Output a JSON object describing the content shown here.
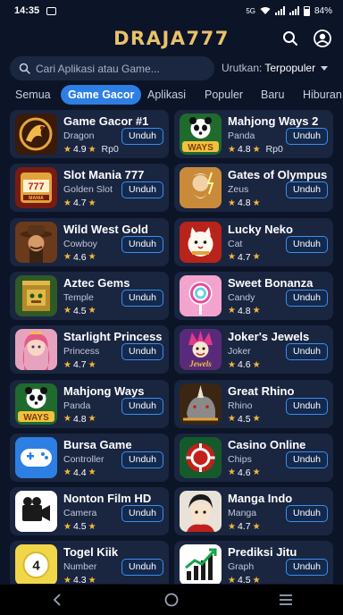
{
  "status": {
    "time": "14:35",
    "battery": "84%",
    "network": "5G"
  },
  "header": {
    "brand": "DRAJA777"
  },
  "search": {
    "placeholder": "Cari Aplikasi atau Game..."
  },
  "sort": {
    "label": "Urutkan:",
    "value": "Terpopuler"
  },
  "tabs": [
    "Semua",
    "Game Gacor",
    "Aplikasi",
    "Populer",
    "Baru",
    "Hiburan"
  ],
  "active_tab": "Game Gacor",
  "apps": [
    {
      "title": "Game Gacor #1",
      "category": "Dragon",
      "rating": "4.9",
      "price": "Rp0",
      "button": "Unduh",
      "icon": "dragon-icon",
      "bg": "#3a1a08"
    },
    {
      "title": "Mahjong Ways 2",
      "category": "Panda",
      "rating": "4.8",
      "price": "Rp0",
      "button": "Unduh",
      "icon": "panda-ways-icon",
      "bg": "#1f6b2e"
    },
    {
      "title": "Slot Mania 777",
      "category": "Golden Slot",
      "rating": "4.7",
      "price": "",
      "button": "Unduh",
      "icon": "slot-machine-icon",
      "bg": "#7a1b12"
    },
    {
      "title": "Gates of Olympus",
      "category": "Zeus",
      "rating": "4.8",
      "price": "",
      "button": "Unduh",
      "icon": "zeus-icon",
      "bg": "#c98b3a"
    },
    {
      "title": "Wild West Gold",
      "category": "Cowboy",
      "rating": "4.6",
      "price": "",
      "button": "Unduh",
      "icon": "cowboy-icon",
      "bg": "#6b3a1c"
    },
    {
      "title": "Lucky Neko",
      "category": "Cat",
      "rating": "4.7",
      "price": "",
      "button": "Unduh",
      "icon": "lucky-cat-icon",
      "bg": "#b8241c"
    },
    {
      "title": "Aztec Gems",
      "category": "Temple",
      "rating": "4.5",
      "price": "",
      "button": "Unduh",
      "icon": "aztec-temple-icon",
      "bg": "#2f5a26"
    },
    {
      "title": "Sweet Bonanza",
      "category": "Candy",
      "rating": "4.8",
      "price": "",
      "button": "Unduh",
      "icon": "candy-icon",
      "bg": "#f2a4cf"
    },
    {
      "title": "Starlight Princess",
      "category": "Princess",
      "rating": "4.7",
      "price": "",
      "button": "Unduh",
      "icon": "princess-icon",
      "bg": "#e7a3bd"
    },
    {
      "title": "Joker's Jewels",
      "category": "Joker",
      "rating": "4.6",
      "price": "",
      "button": "Unduh",
      "icon": "joker-icon",
      "bg": "#5a2a7a"
    },
    {
      "title": "Mahjong Ways",
      "category": "Panda",
      "rating": "4.8",
      "price": "",
      "button": "Unduh",
      "icon": "panda-ways-icon",
      "bg": "#1f6b2e"
    },
    {
      "title": "Great Rhino",
      "category": "Rhino",
      "rating": "4.5",
      "price": "",
      "button": "Unduh",
      "icon": "rhino-icon",
      "bg": "#3a2612"
    },
    {
      "title": "Bursa Game",
      "category": "Controller",
      "rating": "4.4",
      "price": "",
      "button": "Unduh",
      "icon": "gamepad-icon",
      "bg": "#2d7fe3"
    },
    {
      "title": "Casino Online",
      "category": "Chips",
      "rating": "4.6",
      "price": "",
      "button": "Unduh",
      "icon": "casino-chip-icon",
      "bg": "#155a2a"
    },
    {
      "title": "Nonton Film HD",
      "category": "Camera",
      "rating": "4.5",
      "price": "",
      "button": "Unduh",
      "icon": "video-camera-icon",
      "bg": "#ffffff"
    },
    {
      "title": "Manga Indo",
      "category": "Manga",
      "rating": "4.7",
      "price": "",
      "button": "Unduh",
      "icon": "manga-icon",
      "bg": "#e8e2d8"
    },
    {
      "title": "Togel Kiik",
      "category": "Number",
      "rating": "4.3",
      "price": "",
      "button": "Unduh",
      "icon": "lottery-ball-icon",
      "bg": "#f2d64a"
    },
    {
      "title": "Prediksi Jitu",
      "category": "Graph",
      "rating": "4.5",
      "price": "",
      "button": "Unduh",
      "icon": "growth-chart-icon",
      "bg": "#ffffff"
    }
  ],
  "nav": [
    "back-icon",
    "home-icon",
    "recents-icon"
  ]
}
